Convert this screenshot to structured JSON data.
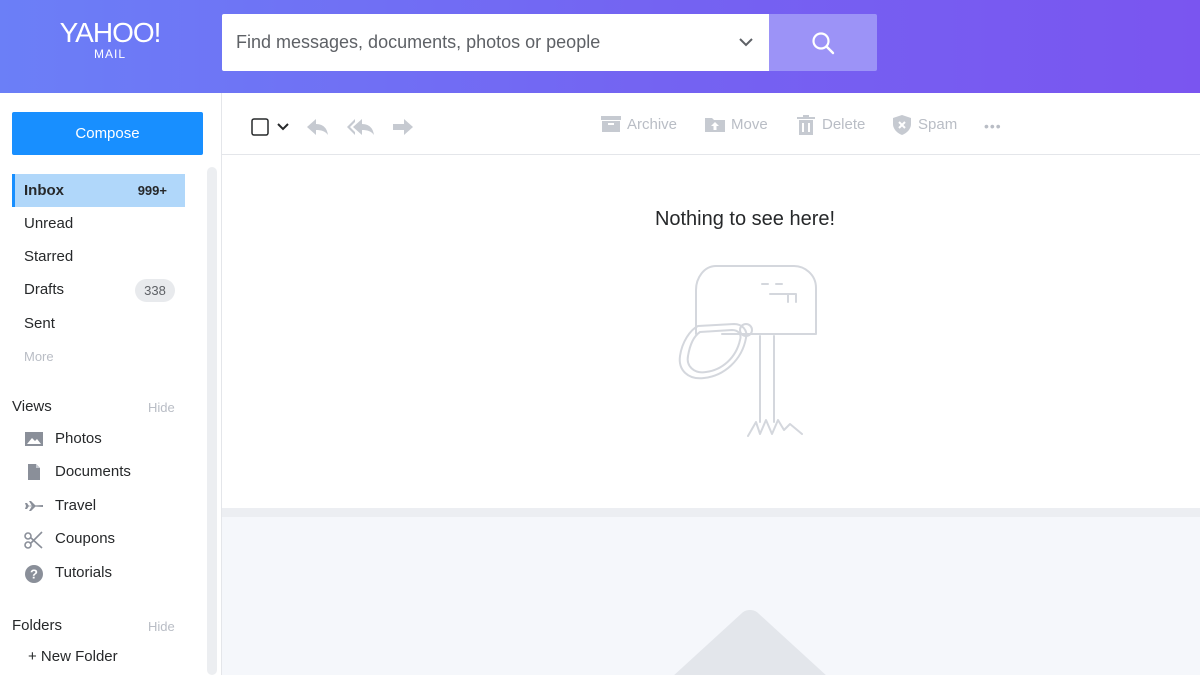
{
  "header": {
    "logo_main": "YAHOO!",
    "logo_sub": "MAIL",
    "search_placeholder": "Find messages, documents, photos or people"
  },
  "sidebar": {
    "compose_label": "Compose",
    "nav": [
      {
        "label": "Inbox",
        "badge": "999+"
      },
      {
        "label": "Unread"
      },
      {
        "label": "Starred"
      },
      {
        "label": "Drafts",
        "badge": "338"
      },
      {
        "label": "Sent"
      }
    ],
    "more_label": "More",
    "views_title": "Views",
    "views_hide": "Hide",
    "views": [
      {
        "label": "Photos",
        "icon": "photo-icon"
      },
      {
        "label": "Documents",
        "icon": "document-icon"
      },
      {
        "label": "Travel",
        "icon": "plane-icon"
      },
      {
        "label": "Coupons",
        "icon": "scissors-icon"
      },
      {
        "label": "Tutorials",
        "icon": "help-icon"
      }
    ],
    "folders_title": "Folders",
    "folders_hide": "Hide",
    "new_folder": "+ New Folder"
  },
  "toolbar": {
    "archive": "Archive",
    "move": "Move",
    "delete": "Delete",
    "spam": "Spam",
    "more": "•••"
  },
  "main": {
    "empty_message": "Nothing to see here!"
  },
  "colors": {
    "accent": "#188fff",
    "header_start": "#6b7ff7",
    "header_end": "#7a55f0",
    "selected": "#b0d7fa",
    "disabled": "#b9bdc5"
  }
}
